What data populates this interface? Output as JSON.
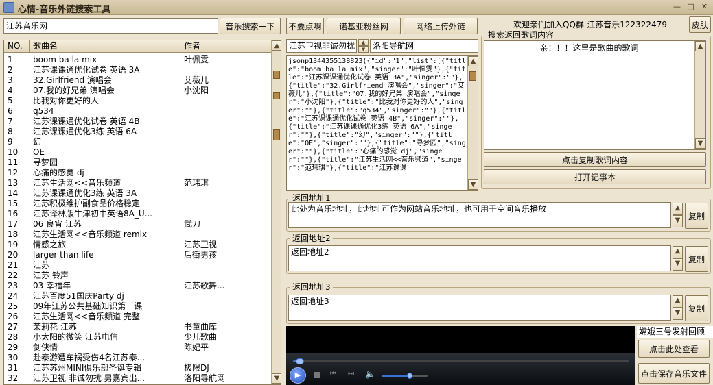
{
  "window": {
    "title": "心情-音乐外链搜索工具",
    "min_glyph": "—",
    "max_glyph": "□",
    "close_glyph": "✕"
  },
  "search": {
    "value": "江苏音乐网",
    "button_label": "音乐搜索一下"
  },
  "toolbar": {
    "btn_no_click": "不要点啊",
    "btn_fans": "诺基亚粉丝网",
    "btn_upload": "网络上传外链",
    "welcome": "欢迎亲们加入QQ群-江苏音乐122322479",
    "btn_skin": "皮肤"
  },
  "songs": {
    "headers": {
      "no": "NO.",
      "title": "歌曲名",
      "singer": "作者"
    },
    "rows": [
      {
        "no": "1",
        "title": "boom ba la mix",
        "singer": "叶佩雯"
      },
      {
        "no": "2",
        "title": "江苏课课通优化试卷 英语 3A",
        "singer": ""
      },
      {
        "no": "3",
        "title": "32.Girlfriend 演唱会",
        "singer": "艾薇儿"
      },
      {
        "no": "4",
        "title": "07.我的好兄弟 演唱会",
        "singer": "小沈阳"
      },
      {
        "no": "5",
        "title": "比我对你更好的人",
        "singer": ""
      },
      {
        "no": "6",
        "title": "q534",
        "singer": ""
      },
      {
        "no": "7",
        "title": "江苏课课通优化试卷 英语 4B",
        "singer": ""
      },
      {
        "no": "8",
        "title": "江苏课课通优化3练 英语 6A",
        "singer": ""
      },
      {
        "no": "9",
        "title": "幻",
        "singer": ""
      },
      {
        "no": "10",
        "title": "OE",
        "singer": ""
      },
      {
        "no": "11",
        "title": "寻梦园",
        "singer": ""
      },
      {
        "no": "12",
        "title": "心痛的感觉 dj",
        "singer": ""
      },
      {
        "no": "13",
        "title": "江苏生活网<<音乐频道",
        "singer": "范玮琪"
      },
      {
        "no": "14",
        "title": "江苏课课通优化3练 英语 3A",
        "singer": ""
      },
      {
        "no": "15",
        "title": "江苏积极维护副食品价格稳定",
        "singer": ""
      },
      {
        "no": "16",
        "title": "江苏译林版牛津初中英语8A_U...",
        "singer": ""
      },
      {
        "no": "17",
        "title": "06 良宵 江苏",
        "singer": "武刀"
      },
      {
        "no": "18",
        "title": "江苏生活网<<音乐频道 remix",
        "singer": ""
      },
      {
        "no": "19",
        "title": "情感之旅",
        "singer": "江苏卫视"
      },
      {
        "no": "20",
        "title": "larger than life",
        "singer": "后街男孩"
      },
      {
        "no": "21",
        "title": "江苏",
        "singer": ""
      },
      {
        "no": "22",
        "title": "江苏 铃声",
        "singer": ""
      },
      {
        "no": "23",
        "title": "03 幸福年",
        "singer": "江苏歌舞..."
      },
      {
        "no": "24",
        "title": "江苏百度51国庆Party dj",
        "singer": ""
      },
      {
        "no": "25",
        "title": "09年江苏公共基础知识第一课",
        "singer": ""
      },
      {
        "no": "26",
        "title": "江苏生活网<<音乐频道 完整",
        "singer": ""
      },
      {
        "no": "27",
        "title": "茉莉花 江苏",
        "singer": "书童曲库"
      },
      {
        "no": "28",
        "title": "小太阳的微笑 江苏电信",
        "singer": "少儿歌曲"
      },
      {
        "no": "29",
        "title": "剑侠情",
        "singer": "陈妃平"
      },
      {
        "no": "30",
        "title": "赴泰游遭车祸受伤4名江苏泰...",
        "singer": ""
      },
      {
        "no": "31",
        "title": "江苏苏州MINI俱乐部圣诞专辑",
        "singer": "极限DJ"
      },
      {
        "no": "32",
        "title": "江苏卫视 非诚勿扰 男嘉宾出...",
        "singer": "洛阳导航网"
      }
    ]
  },
  "json_panel": {
    "selected_title": "江苏卫视非诚勿扰",
    "selected_singer": "洛阳导航网",
    "raw_text": "jsonp1344355138823({\"id\":\"1\",\"list\":[{\"title\":\"boom ba la mix\",\"singer\":\"叶佩雯\"},{\"title\":\"江苏课课通优化试卷 英语 3A\",\"singer\":\"\"},{\"title\":\"32.Girlfriend 演唱会\",\"singer\":\"艾薇儿\"},{\"title\":\"07.我的好兄弟 演唱会\",\"singer\":\"小沈阳\"},{\"title\":\"比我对你更好的人\",\"singer\":\"\"},{\"title\":\"q534\",\"singer\":\"\"},{\"title\":\"江苏课课通优化试卷 英语 4B\",\"singer\":\"\"},{\"title\":\"江苏课课通优化3练 英语 6A\",\"singer\":\"\"},{\"title\":\"幻\",\"singer\":\"\"},{\"title\":\"OE\",\"singer\":\"\"},{\"title\":\"寻梦园\",\"singer\":\"\"},{\"title\":\"心痛的感觉 dj\",\"singer\":\"\"},{\"title\":\"江苏生活网<<音乐频道\",\"singer\":\"范玮琪\"},{\"title\":\"江苏课课"
  },
  "lyrics": {
    "group_label": "搜索返回歌词内容",
    "content": "亲！！！这里是歌曲的歌词",
    "copy_button": "点击复制歌词内容",
    "notepad_button": "打开记事本"
  },
  "addresses": [
    {
      "label": "返回地址1",
      "value": "此处为音乐地址，此地址可作为网站音乐地址，也可用于空间音乐播放",
      "copy": "复制"
    },
    {
      "label": "返回地址2",
      "value": "返回地址2",
      "copy": "复制"
    },
    {
      "label": "返回地址3",
      "value": "返回地址3",
      "copy": "复制"
    }
  ],
  "side": {
    "status": "嫦娥三号发射回顾",
    "view_button": "点击此处查看",
    "save_button": "点击保存音乐文件"
  },
  "player": {
    "progress": 0.02,
    "volume": 0.6
  },
  "colors": {
    "background": "#ece3d0",
    "scroll_thumb": "#b48a4a",
    "player_accent": "#3b6fd6"
  }
}
